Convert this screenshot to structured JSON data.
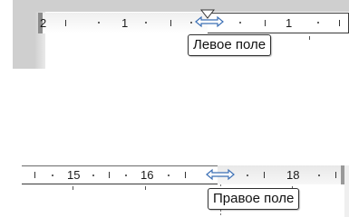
{
  "top_ruler": {
    "labels": [
      "2",
      "1",
      "1"
    ]
  },
  "bottom_ruler": {
    "labels": [
      "15",
      "16",
      "18"
    ]
  },
  "tooltips": {
    "left_margin": "Левое поле",
    "right_margin": "Правое поле"
  },
  "icons": {
    "margin_handle": "double-arrow-icon",
    "indent_marker": "indent-marker-icon"
  },
  "colors": {
    "ruler_border": "#3a3a3a",
    "chrome_grey": "#cfcfcf",
    "handle_blue": "#3b6fb5"
  }
}
